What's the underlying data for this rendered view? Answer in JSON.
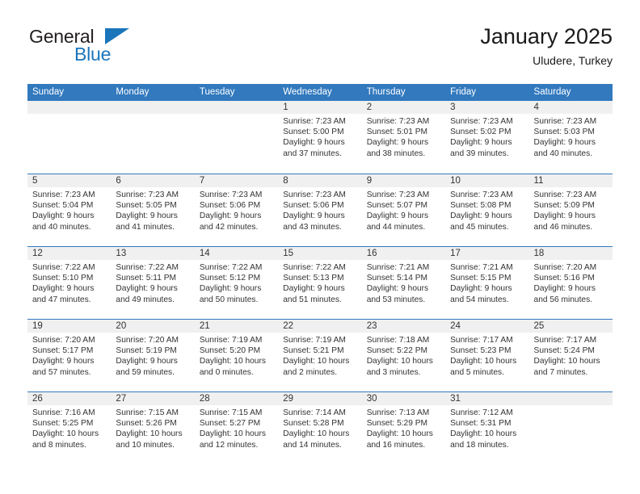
{
  "logo": {
    "primary_text": "General",
    "secondary_text": "Blue",
    "triangle_icon": "triangle-icon",
    "primary_color": "#231f20",
    "secondary_color": "#1b75bb"
  },
  "header": {
    "title": "January 2025",
    "subtitle": "Uludere, Turkey"
  },
  "colors": {
    "header_blue": "#3279be",
    "daynum_band": "#f0f0f0",
    "text": "#333333"
  },
  "calendar": {
    "weekdays": [
      "Sunday",
      "Monday",
      "Tuesday",
      "Wednesday",
      "Thursday",
      "Friday",
      "Saturday"
    ],
    "weeks": [
      [
        {
          "day": ""
        },
        {
          "day": ""
        },
        {
          "day": ""
        },
        {
          "day": "1",
          "sunrise": "Sunrise: 7:23 AM",
          "sunset": "Sunset: 5:00 PM",
          "daylight_line1": "Daylight: 9 hours",
          "daylight_line2": "and 37 minutes."
        },
        {
          "day": "2",
          "sunrise": "Sunrise: 7:23 AM",
          "sunset": "Sunset: 5:01 PM",
          "daylight_line1": "Daylight: 9 hours",
          "daylight_line2": "and 38 minutes."
        },
        {
          "day": "3",
          "sunrise": "Sunrise: 7:23 AM",
          "sunset": "Sunset: 5:02 PM",
          "daylight_line1": "Daylight: 9 hours",
          "daylight_line2": "and 39 minutes."
        },
        {
          "day": "4",
          "sunrise": "Sunrise: 7:23 AM",
          "sunset": "Sunset: 5:03 PM",
          "daylight_line1": "Daylight: 9 hours",
          "daylight_line2": "and 40 minutes."
        }
      ],
      [
        {
          "day": "5",
          "sunrise": "Sunrise: 7:23 AM",
          "sunset": "Sunset: 5:04 PM",
          "daylight_line1": "Daylight: 9 hours",
          "daylight_line2": "and 40 minutes."
        },
        {
          "day": "6",
          "sunrise": "Sunrise: 7:23 AM",
          "sunset": "Sunset: 5:05 PM",
          "daylight_line1": "Daylight: 9 hours",
          "daylight_line2": "and 41 minutes."
        },
        {
          "day": "7",
          "sunrise": "Sunrise: 7:23 AM",
          "sunset": "Sunset: 5:06 PM",
          "daylight_line1": "Daylight: 9 hours",
          "daylight_line2": "and 42 minutes."
        },
        {
          "day": "8",
          "sunrise": "Sunrise: 7:23 AM",
          "sunset": "Sunset: 5:06 PM",
          "daylight_line1": "Daylight: 9 hours",
          "daylight_line2": "and 43 minutes."
        },
        {
          "day": "9",
          "sunrise": "Sunrise: 7:23 AM",
          "sunset": "Sunset: 5:07 PM",
          "daylight_line1": "Daylight: 9 hours",
          "daylight_line2": "and 44 minutes."
        },
        {
          "day": "10",
          "sunrise": "Sunrise: 7:23 AM",
          "sunset": "Sunset: 5:08 PM",
          "daylight_line1": "Daylight: 9 hours",
          "daylight_line2": "and 45 minutes."
        },
        {
          "day": "11",
          "sunrise": "Sunrise: 7:23 AM",
          "sunset": "Sunset: 5:09 PM",
          "daylight_line1": "Daylight: 9 hours",
          "daylight_line2": "and 46 minutes."
        }
      ],
      [
        {
          "day": "12",
          "sunrise": "Sunrise: 7:22 AM",
          "sunset": "Sunset: 5:10 PM",
          "daylight_line1": "Daylight: 9 hours",
          "daylight_line2": "and 47 minutes."
        },
        {
          "day": "13",
          "sunrise": "Sunrise: 7:22 AM",
          "sunset": "Sunset: 5:11 PM",
          "daylight_line1": "Daylight: 9 hours",
          "daylight_line2": "and 49 minutes."
        },
        {
          "day": "14",
          "sunrise": "Sunrise: 7:22 AM",
          "sunset": "Sunset: 5:12 PM",
          "daylight_line1": "Daylight: 9 hours",
          "daylight_line2": "and 50 minutes."
        },
        {
          "day": "15",
          "sunrise": "Sunrise: 7:22 AM",
          "sunset": "Sunset: 5:13 PM",
          "daylight_line1": "Daylight: 9 hours",
          "daylight_line2": "and 51 minutes."
        },
        {
          "day": "16",
          "sunrise": "Sunrise: 7:21 AM",
          "sunset": "Sunset: 5:14 PM",
          "daylight_line1": "Daylight: 9 hours",
          "daylight_line2": "and 53 minutes."
        },
        {
          "day": "17",
          "sunrise": "Sunrise: 7:21 AM",
          "sunset": "Sunset: 5:15 PM",
          "daylight_line1": "Daylight: 9 hours",
          "daylight_line2": "and 54 minutes."
        },
        {
          "day": "18",
          "sunrise": "Sunrise: 7:20 AM",
          "sunset": "Sunset: 5:16 PM",
          "daylight_line1": "Daylight: 9 hours",
          "daylight_line2": "and 56 minutes."
        }
      ],
      [
        {
          "day": "19",
          "sunrise": "Sunrise: 7:20 AM",
          "sunset": "Sunset: 5:17 PM",
          "daylight_line1": "Daylight: 9 hours",
          "daylight_line2": "and 57 minutes."
        },
        {
          "day": "20",
          "sunrise": "Sunrise: 7:20 AM",
          "sunset": "Sunset: 5:19 PM",
          "daylight_line1": "Daylight: 9 hours",
          "daylight_line2": "and 59 minutes."
        },
        {
          "day": "21",
          "sunrise": "Sunrise: 7:19 AM",
          "sunset": "Sunset: 5:20 PM",
          "daylight_line1": "Daylight: 10 hours",
          "daylight_line2": "and 0 minutes."
        },
        {
          "day": "22",
          "sunrise": "Sunrise: 7:19 AM",
          "sunset": "Sunset: 5:21 PM",
          "daylight_line1": "Daylight: 10 hours",
          "daylight_line2": "and 2 minutes."
        },
        {
          "day": "23",
          "sunrise": "Sunrise: 7:18 AM",
          "sunset": "Sunset: 5:22 PM",
          "daylight_line1": "Daylight: 10 hours",
          "daylight_line2": "and 3 minutes."
        },
        {
          "day": "24",
          "sunrise": "Sunrise: 7:17 AM",
          "sunset": "Sunset: 5:23 PM",
          "daylight_line1": "Daylight: 10 hours",
          "daylight_line2": "and 5 minutes."
        },
        {
          "day": "25",
          "sunrise": "Sunrise: 7:17 AM",
          "sunset": "Sunset: 5:24 PM",
          "daylight_line1": "Daylight: 10 hours",
          "daylight_line2": "and 7 minutes."
        }
      ],
      [
        {
          "day": "26",
          "sunrise": "Sunrise: 7:16 AM",
          "sunset": "Sunset: 5:25 PM",
          "daylight_line1": "Daylight: 10 hours",
          "daylight_line2": "and 8 minutes."
        },
        {
          "day": "27",
          "sunrise": "Sunrise: 7:15 AM",
          "sunset": "Sunset: 5:26 PM",
          "daylight_line1": "Daylight: 10 hours",
          "daylight_line2": "and 10 minutes."
        },
        {
          "day": "28",
          "sunrise": "Sunrise: 7:15 AM",
          "sunset": "Sunset: 5:27 PM",
          "daylight_line1": "Daylight: 10 hours",
          "daylight_line2": "and 12 minutes."
        },
        {
          "day": "29",
          "sunrise": "Sunrise: 7:14 AM",
          "sunset": "Sunset: 5:28 PM",
          "daylight_line1": "Daylight: 10 hours",
          "daylight_line2": "and 14 minutes."
        },
        {
          "day": "30",
          "sunrise": "Sunrise: 7:13 AM",
          "sunset": "Sunset: 5:29 PM",
          "daylight_line1": "Daylight: 10 hours",
          "daylight_line2": "and 16 minutes."
        },
        {
          "day": "31",
          "sunrise": "Sunrise: 7:12 AM",
          "sunset": "Sunset: 5:31 PM",
          "daylight_line1": "Daylight: 10 hours",
          "daylight_line2": "and 18 minutes."
        },
        {
          "day": ""
        }
      ]
    ]
  }
}
